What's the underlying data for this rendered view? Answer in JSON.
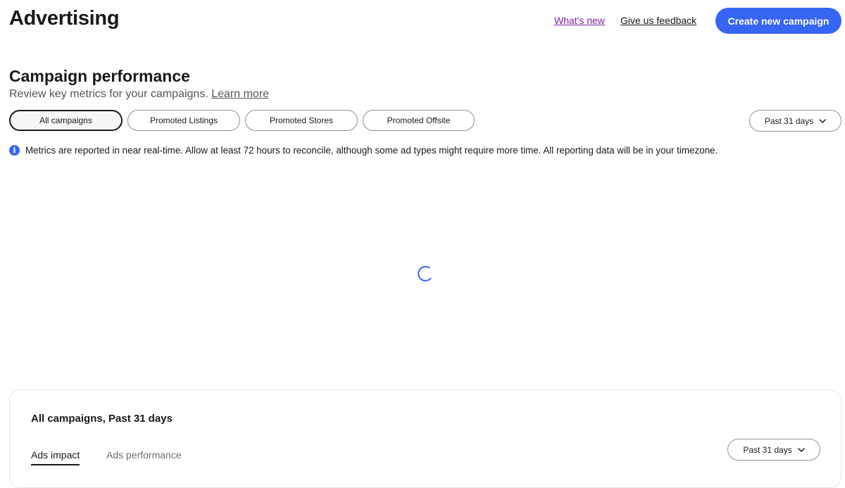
{
  "header": {
    "title": "Advertising",
    "whats_new": "What's new",
    "feedback": "Give us feedback",
    "create_campaign": "Create new campaign"
  },
  "performance": {
    "title": "Campaign performance",
    "subtitle": "Review key metrics for your campaigns.",
    "learn_more": "Learn more",
    "filters": [
      {
        "label": "All campaigns",
        "selected": true
      },
      {
        "label": "Promoted Listings",
        "selected": false
      },
      {
        "label": "Promoted Stores",
        "selected": false
      },
      {
        "label": "Promoted Offsite",
        "selected": false
      }
    ],
    "date_range": "Past 31 days",
    "notice": "Metrics are reported in near real-time. Allow at least 72 hours to reconcile, although some ad types might require more time. All reporting data will be in your timezone.",
    "loading": true
  },
  "summary_card": {
    "title": "All campaigns, Past 31 days",
    "tabs": [
      {
        "label": "Ads impact",
        "selected": true
      },
      {
        "label": "Ads performance",
        "selected": false
      }
    ],
    "date_range": "Past 31 days"
  },
  "icons": {
    "info": "info-icon",
    "chevron": "chevron-down-icon",
    "spinner": "loading-spinner-icon"
  },
  "colors": {
    "primary": "#3665f3",
    "visited_link": "#7b1fa2",
    "text": "#191919",
    "muted": "#555555"
  }
}
